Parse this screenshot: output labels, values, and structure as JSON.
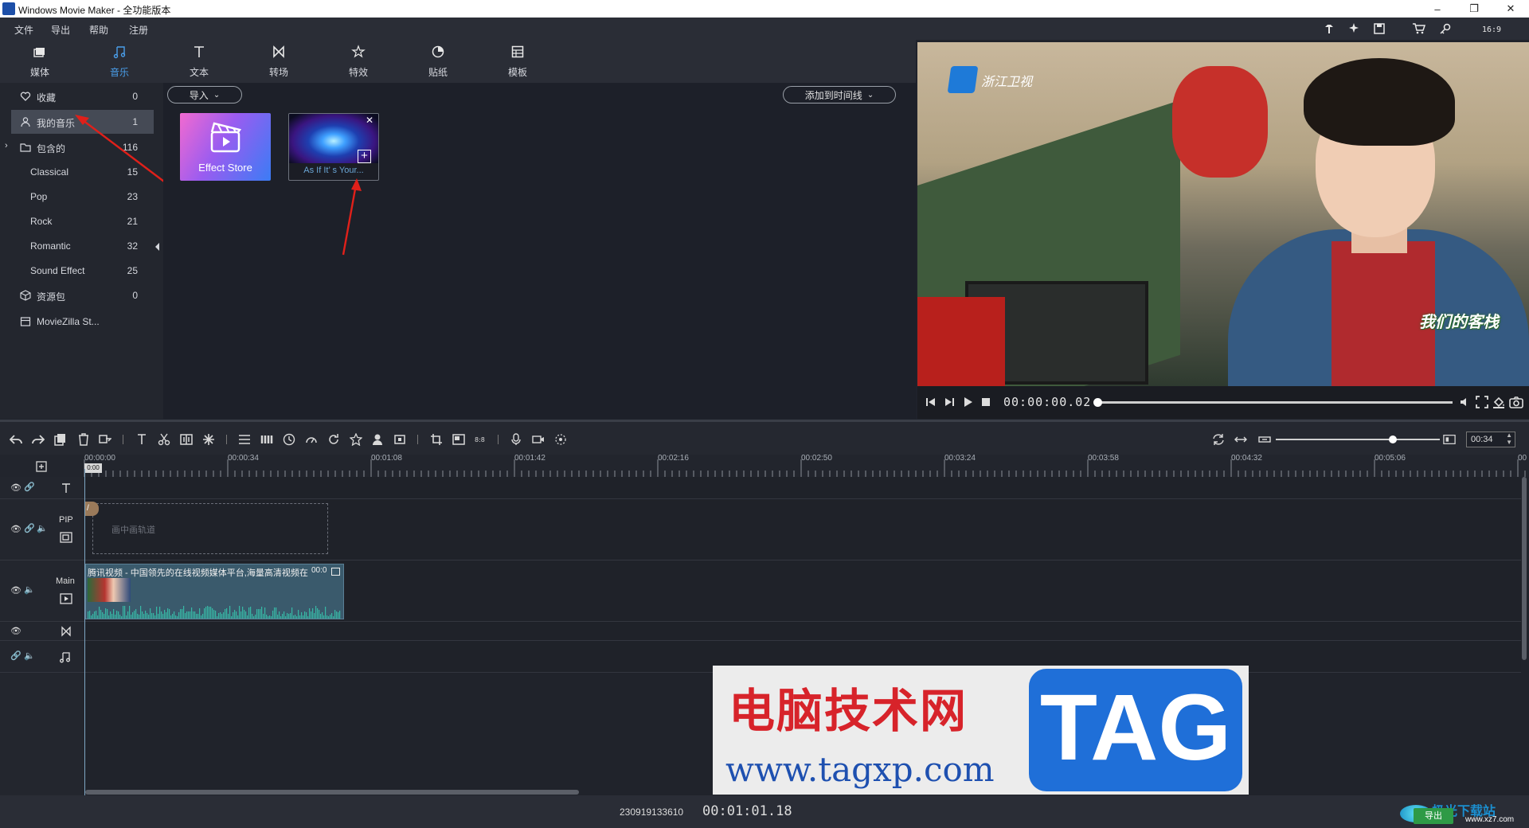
{
  "window": {
    "title": "Windows Movie Maker - 全功能版本"
  },
  "menu": [
    "文件",
    "导出",
    "帮助",
    "注册"
  ],
  "tabs": [
    {
      "label": "媒体",
      "icon": "media-icon"
    },
    {
      "label": "音乐",
      "icon": "music-icon",
      "active": true
    },
    {
      "label": "文本",
      "icon": "text-icon"
    },
    {
      "label": "转场",
      "icon": "transition-icon"
    },
    {
      "label": "特效",
      "icon": "effect-icon"
    },
    {
      "label": "贴纸",
      "icon": "sticker-icon"
    },
    {
      "label": "模板",
      "icon": "template-icon"
    }
  ],
  "sidebar": {
    "items": [
      {
        "label": "收藏",
        "count": "0",
        "icon": "heart-icon"
      },
      {
        "label": "我的音乐",
        "count": "1",
        "icon": "user-icon",
        "selected": true
      },
      {
        "label": "包含的",
        "count": "116",
        "icon": "folder-icon"
      },
      {
        "label": "Classical",
        "count": "15"
      },
      {
        "label": "Pop",
        "count": "23"
      },
      {
        "label": "Rock",
        "count": "21"
      },
      {
        "label": "Romantic",
        "count": "32"
      },
      {
        "label": "Sound Effect",
        "count": "25"
      },
      {
        "label": "资源包",
        "count": "0",
        "icon": "package-icon"
      },
      {
        "label": "MovieZilla St...",
        "count": "",
        "icon": "store-icon"
      }
    ]
  },
  "browser": {
    "import_label": "导入",
    "add_to_timeline_label": "添加到时间线",
    "effect_store_label": "Effect Store",
    "music_item_label": "As If It’ s Your..."
  },
  "preview": {
    "channel_logo_text": "浙江卫视",
    "show_logo_text": "我们的客栈",
    "timecode": "00:00:00.02"
  },
  "timeline": {
    "zoom_value": "00:34",
    "ruler_ticks": [
      "00:00:00",
      "00:00:34",
      "00:01:08",
      "00:01:42",
      "00:02:16",
      "00:02:50",
      "00:03:24",
      "00:03:58",
      "00:04:32",
      "00:05:06",
      "00"
    ],
    "playhead_label": "0:00",
    "tracks": {
      "pip_label": "PIP",
      "pip_placeholder": "画中画轨道",
      "main_label": "Main",
      "main_clip_title": "腾讯视频 - 中国领先的在线视频媒体平台,海量高清视频在",
      "main_clip_time": "00:0"
    }
  },
  "status": {
    "id_text": "230919133610",
    "total_time": "00:01:01.18"
  },
  "watermark": {
    "site_cn": "电脑技术网",
    "url": "www.tagxp.com",
    "tag": "TAG",
    "corner_cn": "极光下载站",
    "corner_url": "www.xz7.com",
    "export_label": "导出"
  },
  "colors": {
    "accent": "#4a9eea",
    "arrow": "#e0201a",
    "clip": "#3a5a6c",
    "wave": "#37b8a6"
  }
}
